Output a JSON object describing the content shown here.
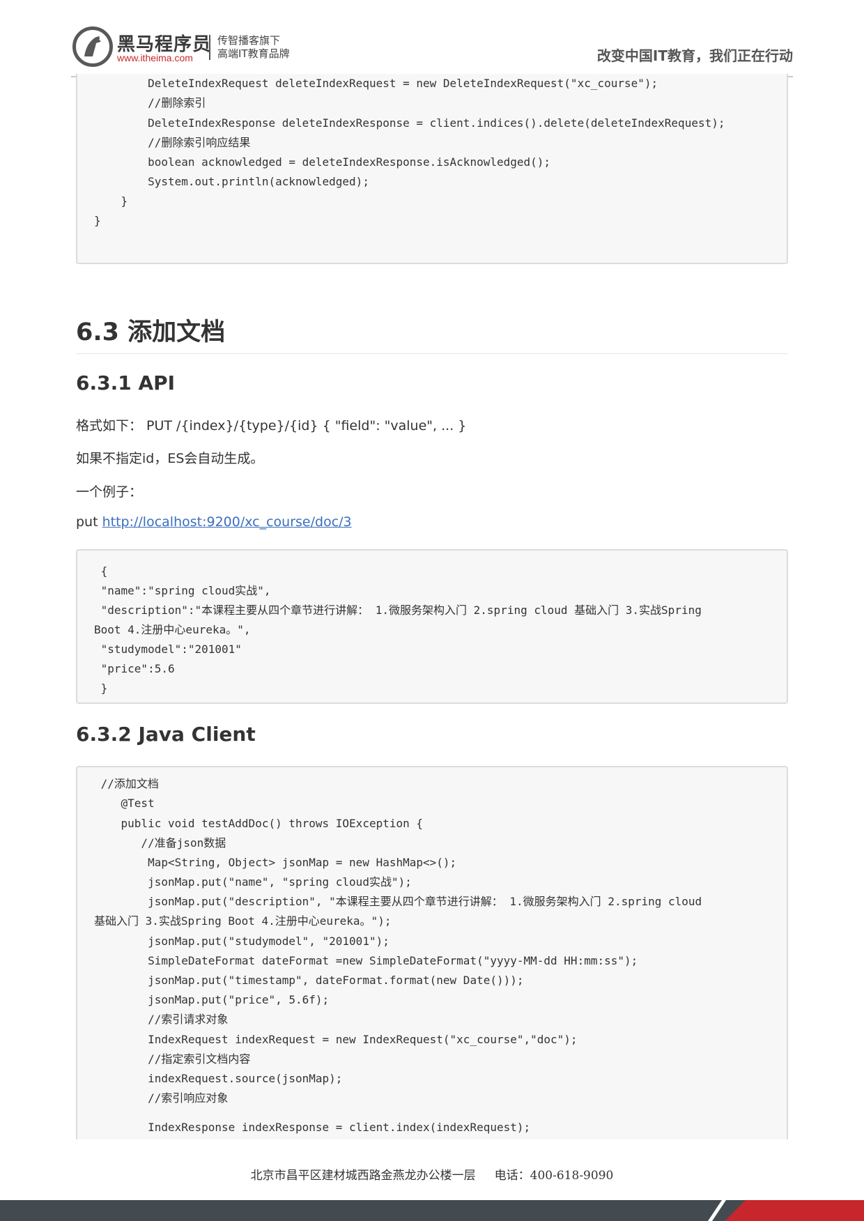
{
  "header": {
    "brand_name": "黑马程序员",
    "brand_url": "www.itheima.com",
    "tagline_1": "传智播客旗下",
    "tagline_2": "高端IT教育品牌",
    "slogan": "改变中国IT教育，我们正在行动"
  },
  "code_block_1": {
    "lines": [
      "        DeleteIndexRequest deleteIndexRequest = new DeleteIndexRequest(\"xc_course\");",
      "        //删除索引",
      "        DeleteIndexResponse deleteIndexResponse = client.indices().delete(deleteIndexRequest);",
      "        //删除索引响应结果",
      "        boolean acknowledged = deleteIndexResponse.isAcknowledged();",
      "        System.out.println(acknowledged);",
      "    }",
      "}"
    ]
  },
  "section_6_3": {
    "title": "6.3 添加文档"
  },
  "section_6_3_1": {
    "title": "6.3.1 API",
    "format_line": "格式如下： PUT /{index}/{type}/{id} { \"field\": \"value\", ... }",
    "id_note": "如果不指定id，ES会自动生成。",
    "example_label": "一个例子：",
    "put_prefix": "put ",
    "put_url": "http://localhost:9200/xc_course/doc/3"
  },
  "code_block_2": {
    "lines": [
      " {",
      " \"name\":\"spring cloud实战\",",
      " \"description\":\"本课程主要从四个章节进行讲解： 1.微服务架构入门 2.spring cloud 基础入门 3.实战Spring",
      "Boot 4.注册中心eureka。\",",
      " \"studymodel\":\"201001\"",
      " \"price\":5.6",
      " }"
    ]
  },
  "section_6_3_2": {
    "title": "6.3.2 Java Client"
  },
  "code_block_3": {
    "lines": [
      " //添加文档",
      "    @Test",
      "    public void testAddDoc() throws IOException {",
      "       //准备json数据",
      "        Map<String, Object> jsonMap = new HashMap<>();",
      "        jsonMap.put(\"name\", \"spring cloud实战\");",
      "        jsonMap.put(\"description\", \"本课程主要从四个章节进行讲解： 1.微服务架构入门 2.spring cloud",
      "基础入门 3.实战Spring Boot 4.注册中心eureka。\");",
      "        jsonMap.put(\"studymodel\", \"201001\");",
      "        SimpleDateFormat dateFormat =new SimpleDateFormat(\"yyyy‐MM‐dd HH:mm:ss\");",
      "        jsonMap.put(\"timestamp\", dateFormat.format(new Date()));",
      "        jsonMap.put(\"price\", 5.6f);",
      "        //索引请求对象",
      "        IndexRequest indexRequest = new IndexRequest(\"xc_course\",\"doc\");",
      "        //指定索引文档内容",
      "        indexRequest.source(jsonMap);",
      "        //索引响应对象",
      "        IndexResponse indexResponse = client.index(indexRequest);"
    ]
  },
  "footer": {
    "address": "北京市昌平区建材城西路金燕龙办公楼一层     电话：400-618-9090"
  }
}
